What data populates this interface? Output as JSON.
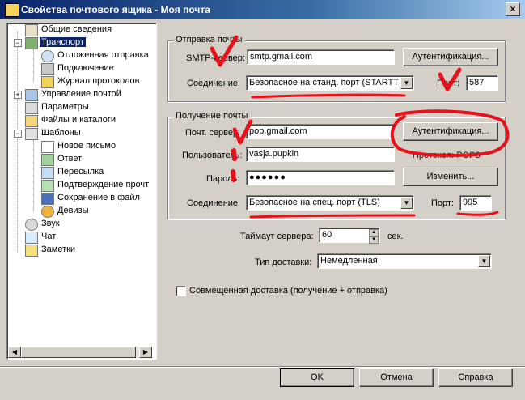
{
  "window": {
    "title": "Свойства почтового ящика - Моя почта",
    "close_glyph": "×"
  },
  "tree": {
    "items": [
      {
        "label": "Общие сведения",
        "icon": "info-icon"
      },
      {
        "label": "Транспорт",
        "icon": "transport-icon",
        "selected": true
      },
      {
        "label": "Отложенная отправка",
        "icon": "clock-icon"
      },
      {
        "label": "Подключение",
        "icon": "connection-icon"
      },
      {
        "label": "Журнал протоколов",
        "icon": "log-icon"
      },
      {
        "label": "Управление почтой",
        "icon": "mail-icon"
      },
      {
        "label": "Параметры",
        "icon": "settings-icon"
      },
      {
        "label": "Файлы и каталоги",
        "icon": "folder-icon"
      },
      {
        "label": "Шаблоны",
        "icon": "templates-icon"
      },
      {
        "label": "Новое письмо",
        "icon": "new-letter-icon"
      },
      {
        "label": "Ответ",
        "icon": "reply-icon"
      },
      {
        "label": "Пересылка",
        "icon": "forward-icon"
      },
      {
        "label": "Подтверждение прочт",
        "icon": "receipt-icon"
      },
      {
        "label": "Сохранение в файл",
        "icon": "save-icon"
      },
      {
        "label": "Девизы",
        "icon": "mottos-icon"
      },
      {
        "label": "Звук",
        "icon": "sound-icon"
      },
      {
        "label": "Чат",
        "icon": "chat-icon"
      },
      {
        "label": "Заметки",
        "icon": "notes-icon"
      }
    ]
  },
  "send": {
    "group_label": "Отправка почты",
    "smtp_label": "SMTP-сервер:",
    "smtp_value": "smtp.gmail.com",
    "auth_button": "Аутентификация...",
    "conn_label": "Соединение:",
    "conn_value": "Безопасное на станд. порт (STARTTL",
    "port_label": "Порт:",
    "port_value": "587"
  },
  "receive": {
    "group_label": "Получение почты",
    "server_label": "Почт. сервер:",
    "server_value": "pop.gmail.com",
    "auth_button": "Аутентификация...",
    "user_label": "Пользователь:",
    "user_value": "vasja.pupkin",
    "protocol_label": "Протокол:  POP3",
    "pass_label": "Пароль:",
    "pass_value": "●●●●●●",
    "change_button": "Изменить...",
    "conn_label": "Соединение:",
    "conn_value": "Безопасное на спец. порт (TLS)",
    "port_label": "Порт:",
    "port_value": "995"
  },
  "timeout": {
    "label": "Таймаут сервера:",
    "value": "60",
    "unit": "сек."
  },
  "delivery": {
    "label": "Тип доставки:",
    "value": "Немедленная"
  },
  "combined": {
    "label": "Совмещенная доставка (получение + отправка)",
    "checked": false
  },
  "buttons": {
    "ok": "OK",
    "cancel": "Отмена",
    "help": "Справка"
  },
  "colors": {
    "annotation": "#e8101a",
    "selection": "#0a246a",
    "dialog": "#d4d0c8"
  }
}
